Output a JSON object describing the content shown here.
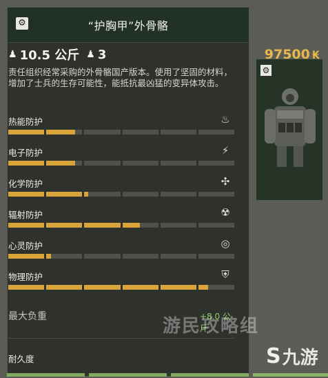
{
  "header": {
    "title": "“护胸甲”外骨骼"
  },
  "stats": {
    "weight": "10.5 公斤",
    "slots": "3",
    "price": "97500",
    "currency_glyph": "₭",
    "weight_icon": "weight-icon",
    "slots_icon": "container-icon"
  },
  "description": "责任组织经常采购的外骨骼国产版本。使用了坚固的材料，增加了士兵的生存可能性，能抵抗最凶猛的变异体攻击。",
  "protections": [
    {
      "label": "热能防护",
      "icon": "fire-icon",
      "glyph": "♨",
      "level": 0.3
    },
    {
      "label": "电子防护",
      "icon": "electric-shield-icon",
      "glyph": "⚡",
      "level": 0.3
    },
    {
      "label": "化学防护",
      "icon": "chemical-icon",
      "glyph": "✣",
      "level": 0.35
    },
    {
      "label": "辐射防护",
      "icon": "radiation-icon",
      "glyph": "☢",
      "level": 0.58
    },
    {
      "label": "心灵防护",
      "icon": "psi-shield-icon",
      "glyph": "◎",
      "level": 0.19
    },
    {
      "label": "物理防护",
      "icon": "armor-shield-icon",
      "glyph": "⛨",
      "level": 0.88
    }
  ],
  "carry_weight": {
    "label": "最大负重",
    "value": "+8.0 公斤"
  },
  "durability": {
    "label": "耐久度"
  },
  "watermark": "游民攻略组",
  "logo": {
    "mark": "S",
    "text": "九游"
  },
  "colors": {
    "accent": "#d9a43a",
    "price": "#e8b84a",
    "header_bg": "#223128",
    "positive": "#8fcf6a"
  }
}
